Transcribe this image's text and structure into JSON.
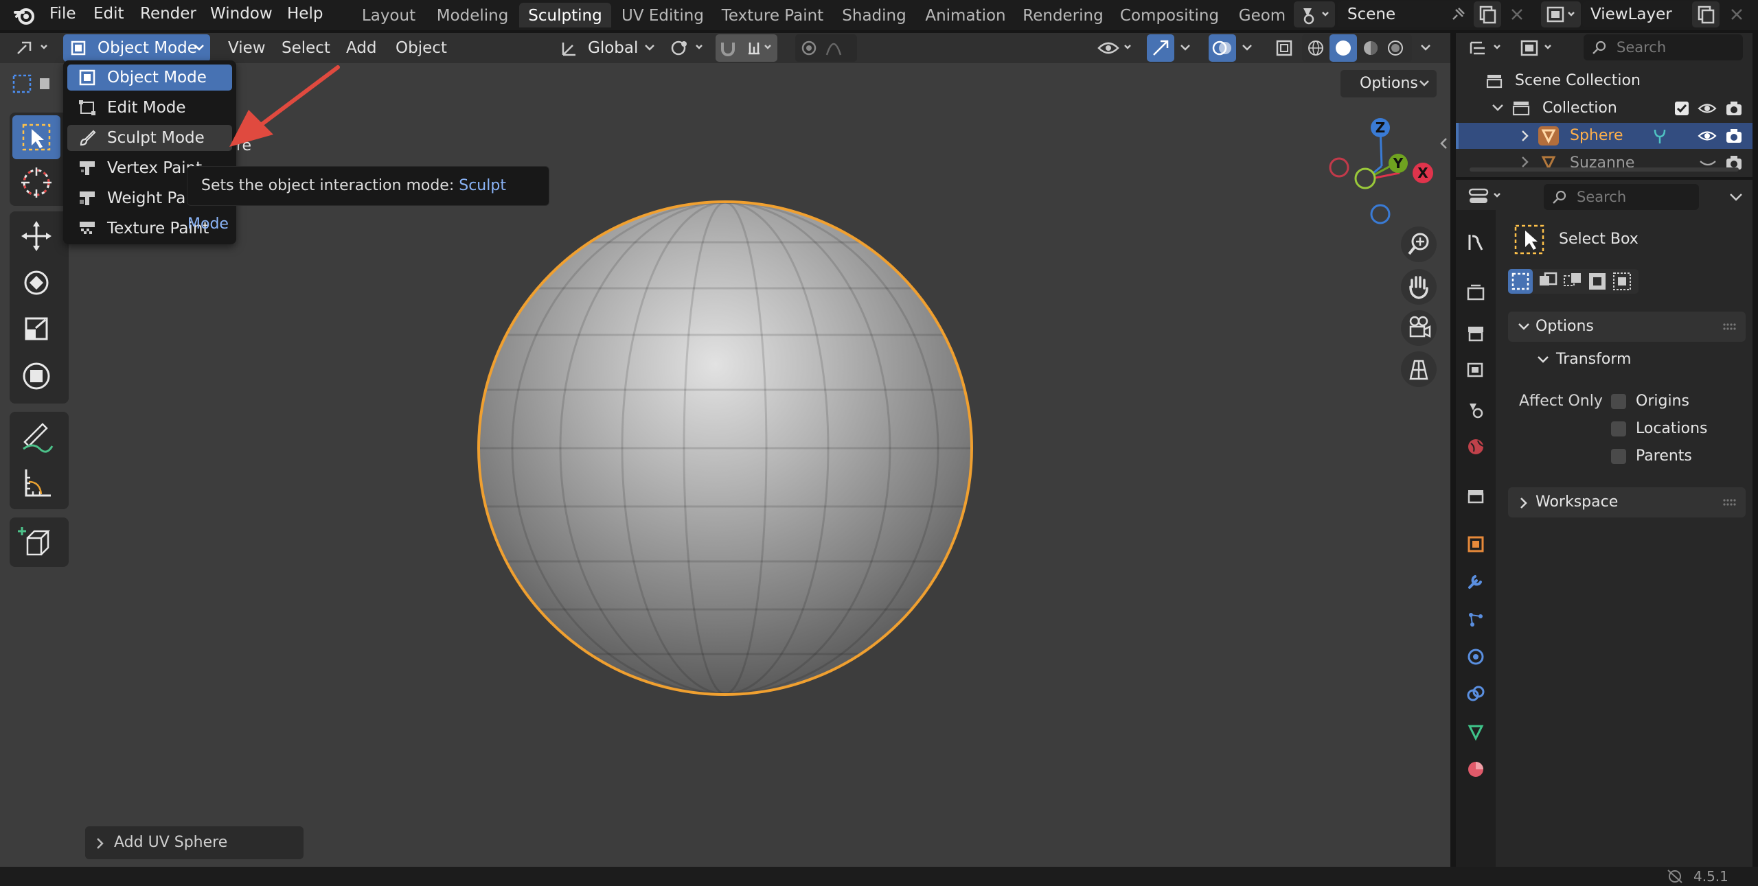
{
  "topbar": {
    "menus": [
      "File",
      "Edit",
      "Render",
      "Window",
      "Help"
    ],
    "workspaces": [
      "Layout",
      "Modeling",
      "Sculpting",
      "UV Editing",
      "Texture Paint",
      "Shading",
      "Animation",
      "Rendering",
      "Compositing",
      "Geom"
    ],
    "active_workspace": "Sculpting",
    "scene": "Scene",
    "view_layer": "ViewLayer"
  },
  "viewport_header": {
    "mode": "Object Mode",
    "menus": [
      "View",
      "Select",
      "Add",
      "Object"
    ],
    "orientation": "Global",
    "options": "Options"
  },
  "mode_dropdown": {
    "items": [
      "Object Mode",
      "Edit Mode",
      "Sculpt Mode",
      "Vertex Paint",
      "Weight Paint",
      "Texture Paint"
    ]
  },
  "hidden_label_fragment": "re",
  "tooltip": {
    "prefix": "Sets the object interaction mode: ",
    "highlight": "Sculpt Mode"
  },
  "gizmo": {
    "z": "Z",
    "y": "Y",
    "x": "X"
  },
  "last_operator": "Add UV Sphere",
  "outliner": {
    "search_placeholder": "Search",
    "scene_collection": "Scene Collection",
    "collection": "Collection",
    "objects": [
      "Sphere",
      "Suzanne"
    ]
  },
  "properties": {
    "search_placeholder": "Search",
    "tool_name": "Select Box",
    "options_label": "Options",
    "transform_label": "Transform",
    "affect_only": "Affect Only",
    "affect_items": [
      "Origins",
      "Locations",
      "Parents"
    ],
    "workspace_label": "Workspace"
  },
  "status": {
    "version": "4.5.1"
  },
  "colors": {
    "accent": "#4772b3",
    "selection_outline": "#f0a030",
    "axis_x": "#e0344c",
    "axis_y": "#6fa320",
    "axis_z": "#3a7bd5",
    "annotation_arrow": "#e04a3f"
  }
}
